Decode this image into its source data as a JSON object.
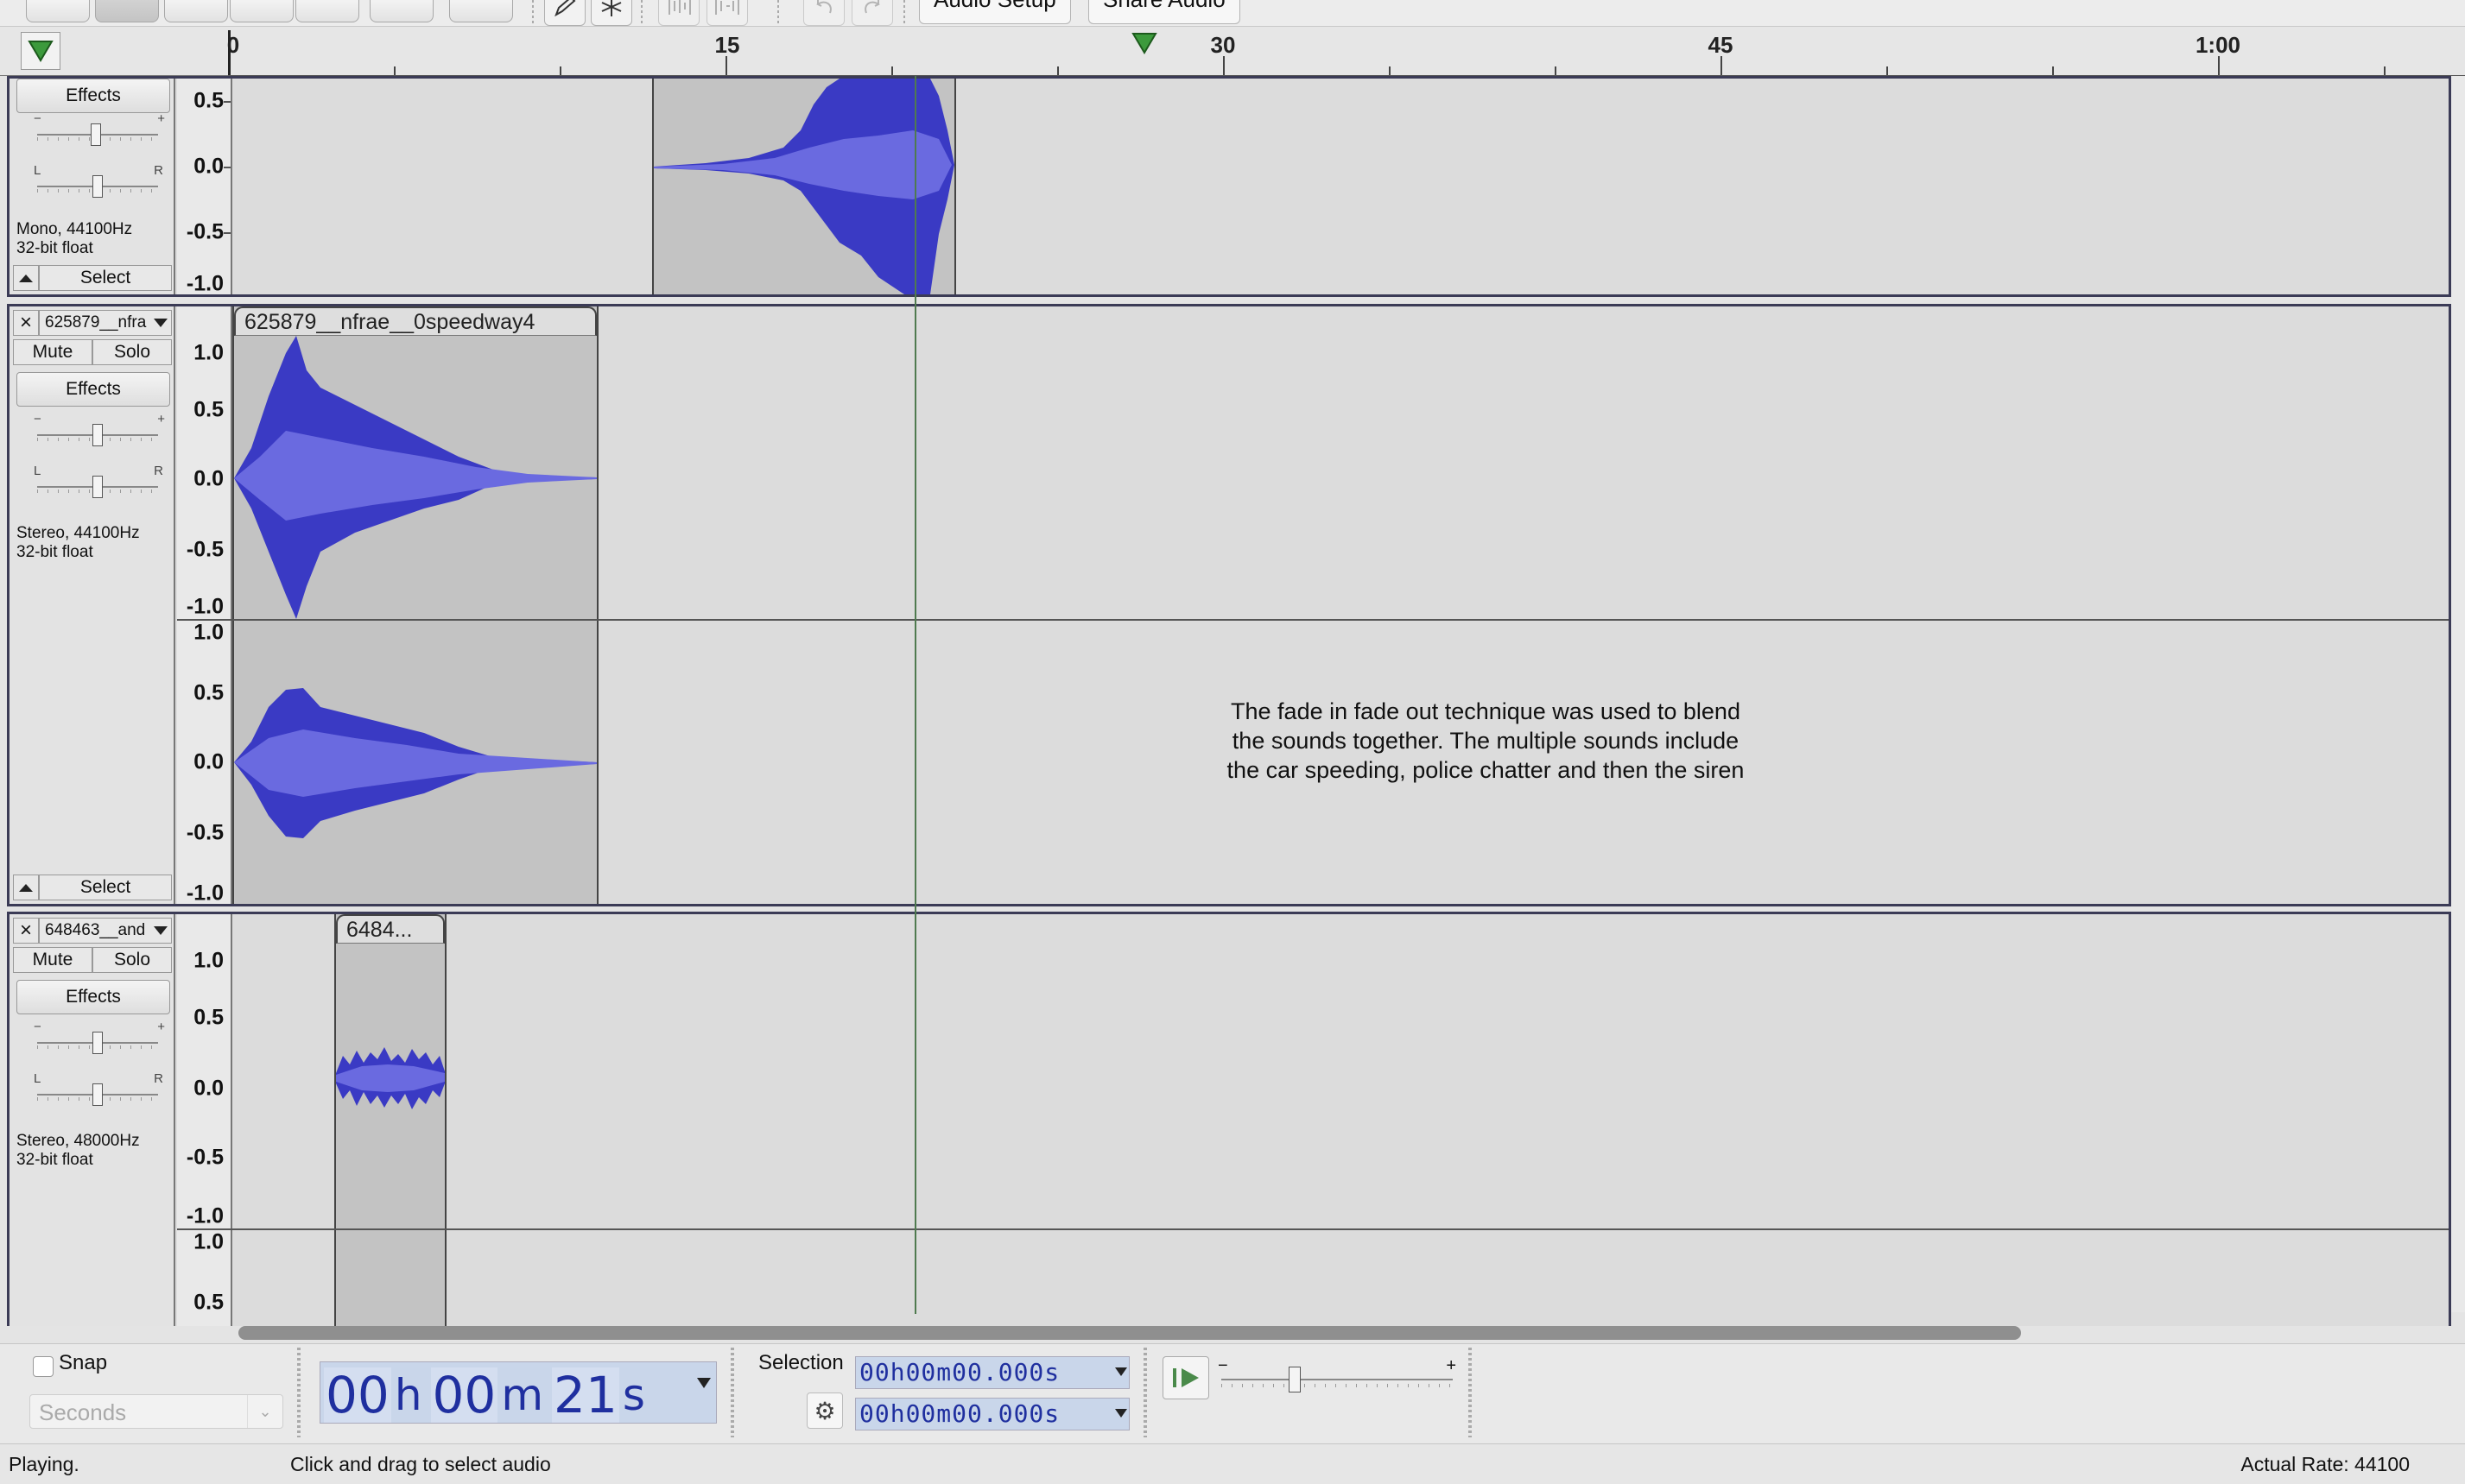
{
  "toolbar": {
    "audio_setup_label": "Audio Setup",
    "share_audio_label": "Share Audio"
  },
  "ruler": {
    "ticks": [
      "0",
      "15",
      "30",
      "45",
      "1:00"
    ]
  },
  "tracks": [
    {
      "name": "",
      "effects_label": "Effects",
      "info": [
        "Mono, 44100Hz",
        "32-bit float"
      ],
      "select_label": "Select",
      "scale": [
        "0.5",
        "0.0",
        "-0.5",
        "-1.0"
      ]
    },
    {
      "name": "625879__nfra",
      "mute_label": "Mute",
      "solo_label": "Solo",
      "effects_label": "Effects",
      "info": [
        "Stereo, 44100Hz",
        "32-bit float"
      ],
      "select_label": "Select",
      "clip_title": "625879__nfrae__0speedway4",
      "scale_ch1": [
        "1.0",
        "0.5",
        "0.0",
        "-0.5",
        "-1.0"
      ],
      "scale_ch2": [
        "1.0",
        "0.5",
        "0.0",
        "-0.5",
        "-1.0"
      ]
    },
    {
      "name": "648463__and",
      "mute_label": "Mute",
      "solo_label": "Solo",
      "effects_label": "Effects",
      "info": [
        "Stereo, 48000Hz",
        "32-bit float"
      ],
      "clip_title": "6484...",
      "scale_ch1": [
        "1.0",
        "0.5",
        "0.0",
        "-0.5",
        "-1.0"
      ],
      "scale_ch2": [
        "1.0",
        "0.5"
      ]
    }
  ],
  "annotation": {
    "lines": [
      "The fade in fade out technique was used to blend",
      "the sounds together. The multiple sounds include",
      "the car speeding, police chatter and then the siren"
    ]
  },
  "bottom": {
    "snap_label": "Snap",
    "snap_unit_placeholder": "Seconds",
    "time": {
      "h": "00",
      "h_unit": "h",
      "m": "00",
      "m_unit": "m",
      "s": "21",
      "s_unit": "s"
    },
    "selection_label": "Selection",
    "selection_start": "00h00m00.000s",
    "selection_end": "00h00m00.000s"
  },
  "status": {
    "state": "Playing.",
    "hint": "Click and drag to select audio",
    "rate": "Actual Rate: 44100"
  },
  "colors": {
    "waveform": "#3a3ac4",
    "waveform_rms": "#6a6ae0",
    "clip_bg": "#c3c3c3",
    "track_border": "#3b3b56",
    "time_display_bg": "#c9d6ea",
    "time_text": "#1f2f9f"
  }
}
